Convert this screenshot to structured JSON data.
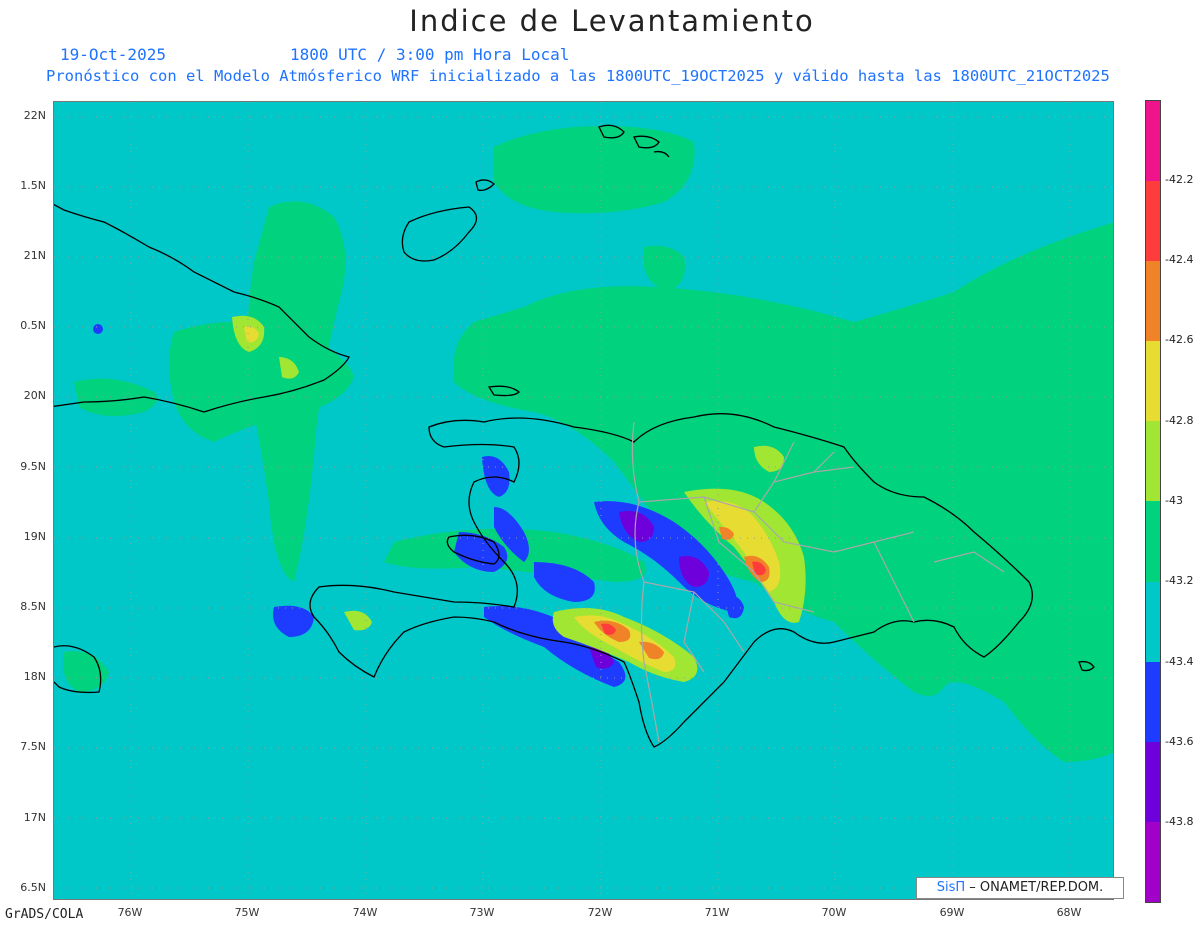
{
  "title": "Indice de Levantamiento",
  "date": "19-Oct-2025",
  "time": "1800 UTC / 3:00 pm Hora Local",
  "description": "Pronóstico con el Modelo Atmósferico WRF inicializado a las 1800UTC_19OCT2025 y válido hasta las  1800UTC_21OCT2025",
  "lat_labels": [
    "22N",
    "1.5N",
    "21N",
    "0.5N",
    "20N",
    "9.5N",
    "19N",
    "8.5N",
    "18N",
    "7.5N",
    "17N",
    "6.5N"
  ],
  "lon_labels": [
    "76W",
    "75W",
    "74W",
    "73W",
    "72W",
    "71W",
    "70W",
    "69W",
    "68W"
  ],
  "colorbar": {
    "labels": [
      "-42.2",
      "-42.4",
      "-42.6",
      "-42.8",
      "-43",
      "-43.2",
      "-43.4",
      "-43.6",
      "-43.8"
    ],
    "colors": [
      "#f0148c",
      "#ff3c3c",
      "#f08228",
      "#e6dc32",
      "#a0e632",
      "#00d27d",
      "#00c8c8",
      "#1e3cff",
      "#6e00dc",
      "#a000c8"
    ]
  },
  "map": {
    "background_color": "#00c8c8",
    "lat_range": [
      16.4,
      22.1
    ],
    "lon_range": [
      -76.7,
      -67.65
    ]
  },
  "credit": {
    "logo": "SisΠ",
    "text": "– ONAMET/REP.DOM."
  },
  "footer": "GrADS/COLA"
}
